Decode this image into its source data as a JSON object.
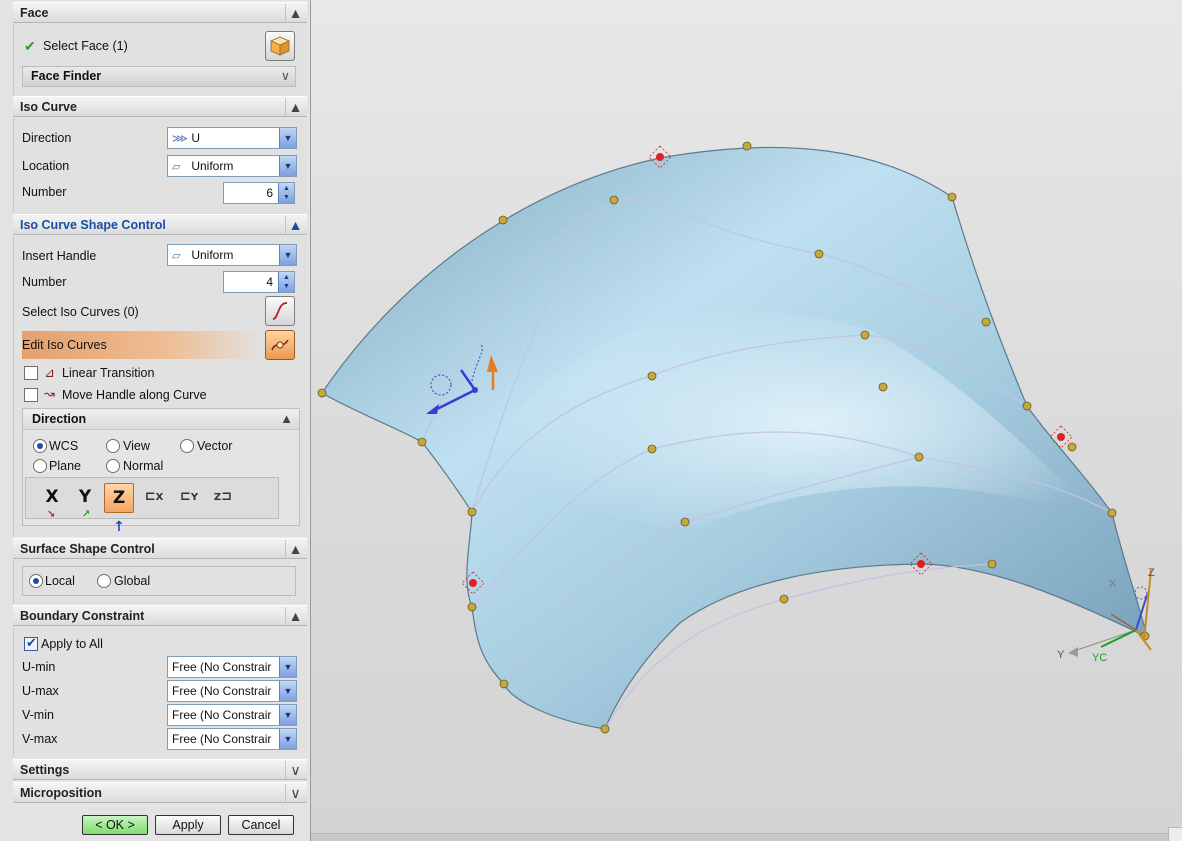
{
  "face": {
    "title": "Face",
    "select_face": "Select Face (1)",
    "face_finder": "Face Finder"
  },
  "iso_curve": {
    "title": "Iso Curve",
    "direction_label": "Direction",
    "direction_value": "U",
    "location_label": "Location",
    "location_value": "Uniform",
    "number_label": "Number",
    "number_value": "6"
  },
  "shape_control": {
    "title": "Iso Curve Shape Control",
    "insert_handle_label": "Insert Handle",
    "insert_handle_value": "Uniform",
    "number_label": "Number",
    "number_value": "4",
    "select_iso_curves": "Select Iso Curves (0)",
    "edit_iso_curves": "Edit Iso Curves",
    "linear_transition": "Linear Transition",
    "move_handle": "Move Handle along Curve",
    "direction_title": "Direction",
    "radios": {
      "wcs": "WCS",
      "view": "View",
      "vector": "Vector",
      "plane": "Plane",
      "normal": "Normal"
    },
    "axis_buttons": {
      "x": "X",
      "y": "Y",
      "z": "Z"
    },
    "selected_direction": "WCS",
    "selected_axis": "Z"
  },
  "surface_shape": {
    "title": "Surface Shape Control",
    "local": "Local",
    "global": "Global",
    "selected": "Local"
  },
  "boundary": {
    "title": "Boundary Constraint",
    "apply_all": "Apply to All",
    "apply_all_checked": true,
    "rows": [
      {
        "label": "U-min",
        "value": "Free (No Constrair"
      },
      {
        "label": "U-max",
        "value": "Free (No Constrair"
      },
      {
        "label": "V-min",
        "value": "Free (No Constrair"
      },
      {
        "label": "V-max",
        "value": "Free (No Constrair"
      }
    ]
  },
  "settings": {
    "title": "Settings"
  },
  "microposition": {
    "title": "Microposition"
  },
  "buttons": {
    "ok": "< OK >",
    "apply": "Apply",
    "cancel": "Cancel"
  },
  "triad": {
    "z": "Z",
    "x": "X",
    "y": "Y",
    "yc": "YC"
  },
  "colors": {
    "surface": "#a9cfe2",
    "highlight_section": "#e8a66c",
    "control_point": "#c4a840",
    "handle_point": "#e02020",
    "ok_button": "#8fe07e"
  }
}
